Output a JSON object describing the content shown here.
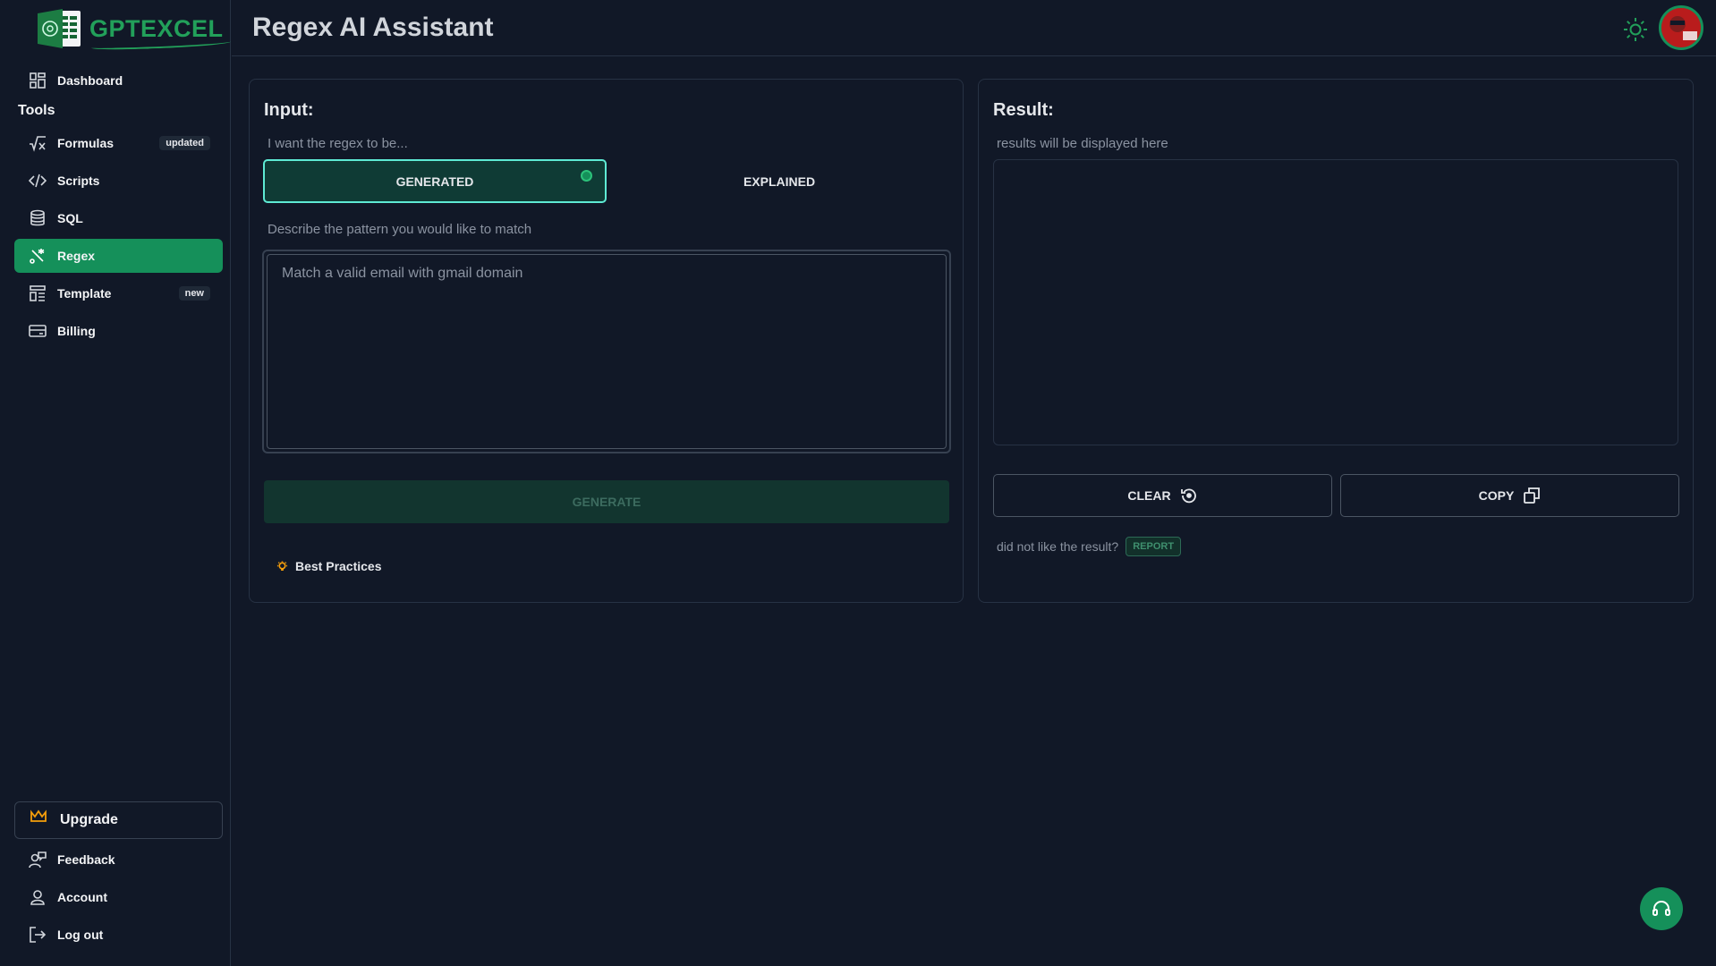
{
  "app": {
    "logo_text": "GPTEXCEL",
    "page_title": "Regex AI Assistant"
  },
  "sidebar": {
    "dashboard": {
      "label": "Dashboard",
      "icon": "dashboard-icon"
    },
    "tools_heading": "Tools",
    "items": [
      {
        "label": "Formulas",
        "badge": "updated",
        "icon": "formula-icon"
      },
      {
        "label": "Scripts",
        "badge": "",
        "icon": "code-icon"
      },
      {
        "label": "SQL",
        "badge": "",
        "icon": "database-icon"
      },
      {
        "label": "Regex",
        "badge": "",
        "icon": "regex-icon",
        "active": true
      },
      {
        "label": "Template",
        "badge": "new",
        "icon": "template-icon"
      },
      {
        "label": "Billing",
        "badge": "",
        "icon": "credit-card-icon"
      }
    ],
    "upgrade_label": "Upgrade",
    "bottom": [
      {
        "label": "Feedback",
        "icon": "feedback-icon"
      },
      {
        "label": "Account",
        "icon": "user-icon"
      },
      {
        "label": "Log out",
        "icon": "logout-icon"
      }
    ]
  },
  "input_panel": {
    "heading": "Input:",
    "mode_label": "I want the regex to be...",
    "modes": [
      {
        "label": "GENERATED",
        "selected": true
      },
      {
        "label": "EXPLAINED",
        "selected": false
      }
    ],
    "pattern_label": "Describe the pattern you would like to match",
    "pattern_value": "",
    "pattern_placeholder": "Match a valid email with gmail domain",
    "generate_label": "GENERATE",
    "best_practices_label": "Best Practices"
  },
  "result_panel": {
    "heading": "Result:",
    "placeholder_label": "results will be displayed here",
    "clear_label": "CLEAR",
    "copy_label": "COPY",
    "feedback_prompt": "did not like the result?",
    "report_label": "REPORT"
  },
  "colors": {
    "background": "#111827",
    "accent": "#15905a",
    "selected_toggle_border": "#5eead4",
    "upgrade_icon": "#f59e0b"
  }
}
